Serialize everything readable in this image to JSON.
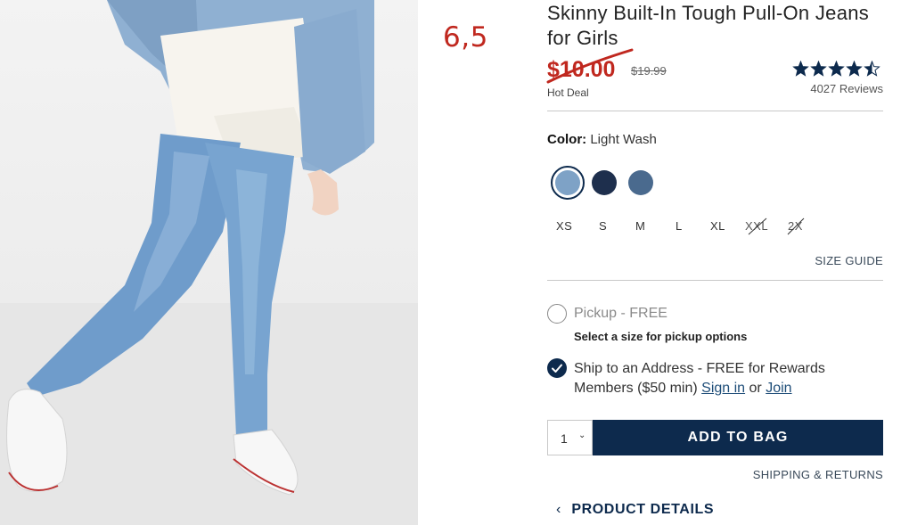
{
  "handwritten_note": "6,5",
  "product": {
    "title": "Skinny Built-In Tough Pull-On Jeans for Girls",
    "sale_price": "$10.00",
    "original_price": "$19.99",
    "deal_label": "Hot Deal",
    "rating": 4.5,
    "rating_max": 5,
    "reviews": "4027 Reviews"
  },
  "color": {
    "label": "Color:",
    "selected": "Light Wash",
    "swatches": [
      {
        "name": "Light Wash",
        "hex": "#7ea2c6",
        "selected": true
      },
      {
        "name": "dark",
        "hex": "#1e2f4d",
        "selected": false
      },
      {
        "name": "medium",
        "hex": "#4a6a8e",
        "selected": false
      }
    ]
  },
  "sizes": [
    {
      "label": "XS",
      "available": true
    },
    {
      "label": "S",
      "available": true
    },
    {
      "label": "M",
      "available": true
    },
    {
      "label": "L",
      "available": true
    },
    {
      "label": "XL",
      "available": true
    },
    {
      "label": "XXL",
      "available": false
    },
    {
      "label": "2X",
      "available": false
    }
  ],
  "size_guide": "SIZE GUIDE",
  "fulfillment": {
    "pickup_label": "Pickup - FREE",
    "pickup_note": "Select a size for pickup options",
    "ship_label": "Ship to an Address - FREE for Rewards Members ($50 min)",
    "sign_in": "Sign in",
    "or": "or",
    "join": "Join"
  },
  "cart": {
    "quantity": "1",
    "add_to_bag": "ADD TO BAG"
  },
  "shipping_returns": "SHIPPING & RETURNS",
  "product_details": "PRODUCT DETAILS",
  "colors": {
    "navy": "#0d2a4d",
    "sale_red": "#c0281f"
  }
}
